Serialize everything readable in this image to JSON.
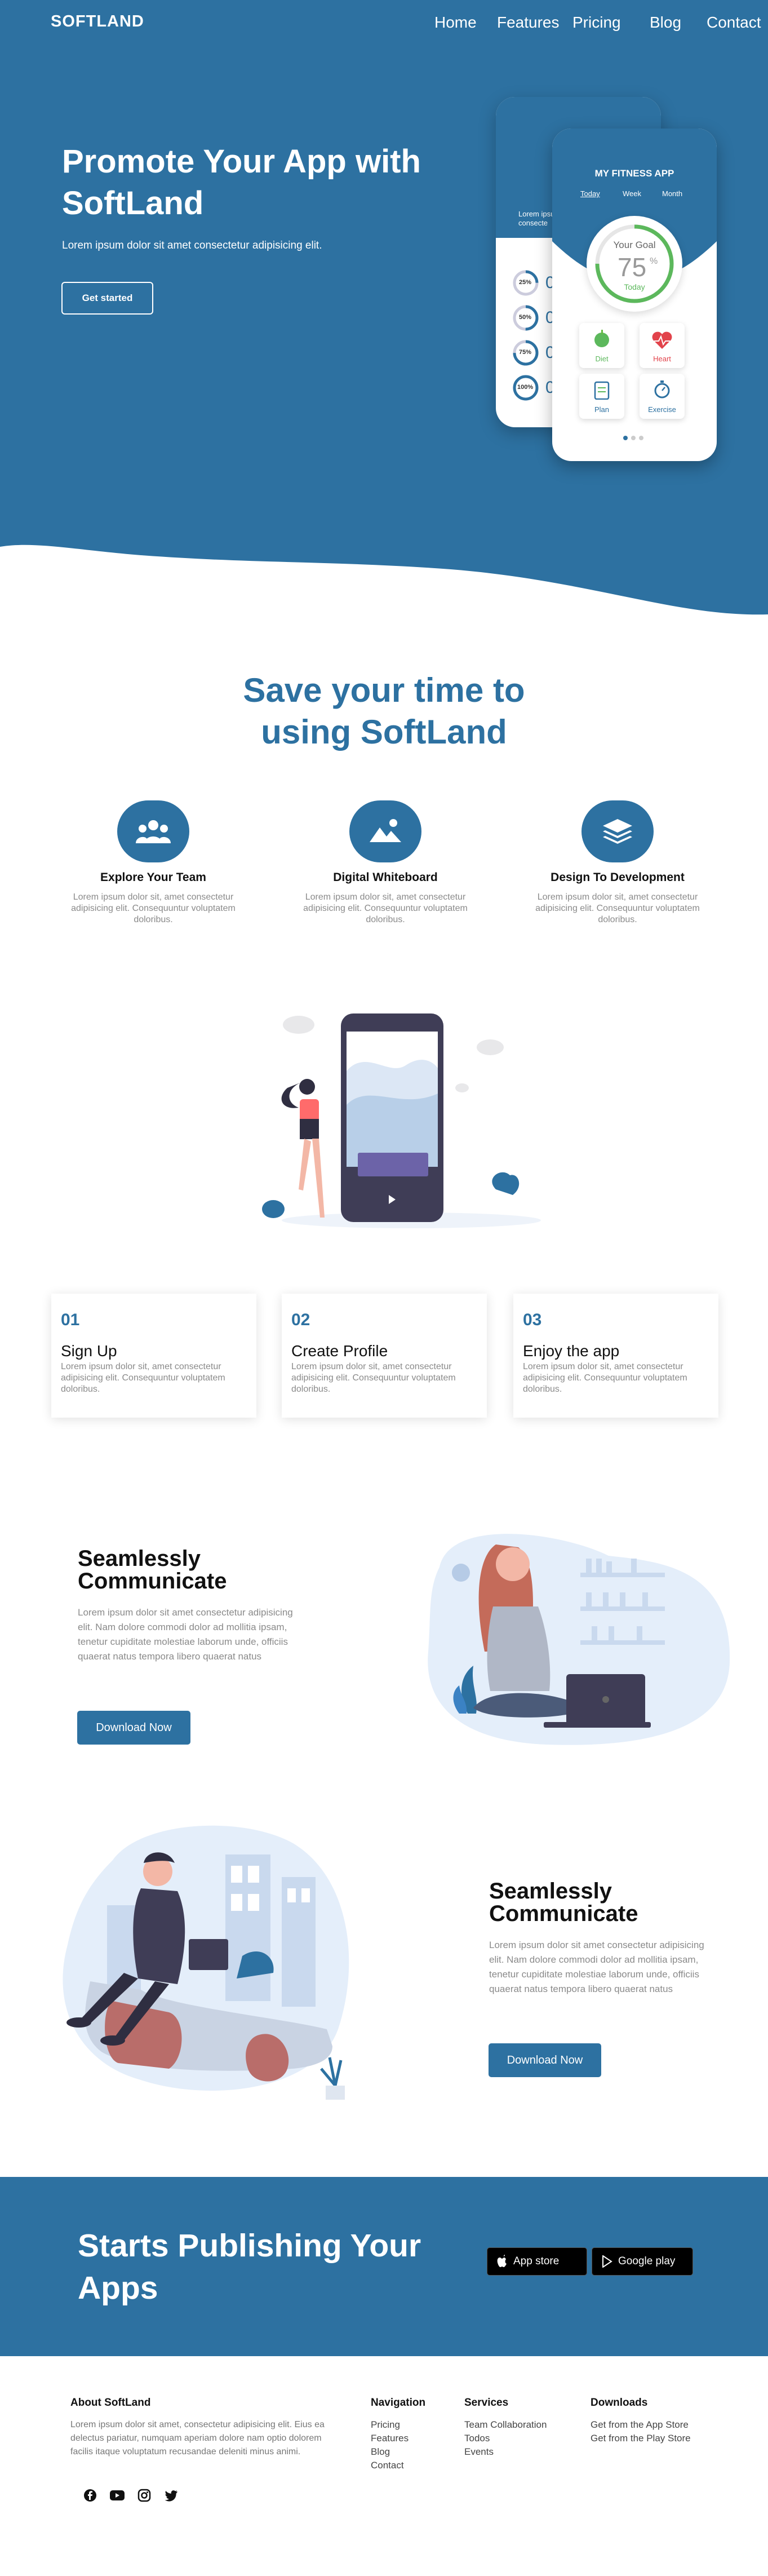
{
  "nav": {
    "brand": "SOFTLAND",
    "links": [
      "Home",
      "Features",
      "Pricing",
      "Blog",
      "Contact"
    ]
  },
  "hero": {
    "title": "Promote Your App with SoftLand",
    "subtitle": "Lorem ipsum dolor sit amet consectetur adipisicing elit.",
    "button": "Get started",
    "phone_back": {
      "snippet": "Lorem ipsum consecte",
      "rings": [
        "25%",
        "50%",
        "75%",
        "100%"
      ],
      "ring_side": [
        "0",
        "0",
        "0",
        "0"
      ]
    },
    "phone_front": {
      "app_title": "MY FITNESS APP",
      "tabs": [
        "Today",
        "Week",
        "Month"
      ],
      "goal_label": "Your Goal",
      "goal_value": "75",
      "goal_unit": "%",
      "goal_day": "Today",
      "goal_progress": 0.75,
      "tiles": [
        "Diet",
        "Heart",
        "Plan",
        "Exercise"
      ]
    }
  },
  "features": {
    "title_line1": "Save your time to",
    "title_line2": "using SoftLand",
    "items": [
      {
        "title": "Explore Your Team",
        "desc": "Lorem ipsum dolor sit, amet consectetur adipisicing elit. Consequuntur voluptatem doloribus."
      },
      {
        "title": "Digital Whiteboard",
        "desc": "Lorem ipsum dolor sit, amet consectetur adipisicing elit. Consequuntur voluptatem doloribus."
      },
      {
        "title": "Design To Development",
        "desc": "Lorem ipsum dolor sit, amet consectetur adipisicing elit. Consequuntur voluptatem doloribus."
      }
    ]
  },
  "steps": [
    {
      "num": "01",
      "title": "Sign Up",
      "desc": "Lorem ipsum dolor sit, amet consectetur adipisicing elit. Consequuntur voluptatem doloribus."
    },
    {
      "num": "02",
      "title": "Create Profile",
      "desc": "Lorem ipsum dolor sit, amet consectetur adipisicing elit. Consequuntur voluptatem doloribus."
    },
    {
      "num": "03",
      "title": "Enjoy the app",
      "desc": "Lorem ipsum dolor sit, amet consectetur adipisicing elit. Consequuntur voluptatem doloribus."
    }
  ],
  "communicate": [
    {
      "title_line1": "Seamlessly",
      "title_line2": "Communicate",
      "desc": "Lorem ipsum dolor sit amet consectetur adipisicing elit. Nam dolore commodi dolor ad mollitia ipsam, tenetur cupiditate molestiae laborum unde, officiis quaerat natus tempora libero quaerat natus",
      "button": "Download Now"
    },
    {
      "title_line1": "Seamlessly",
      "title_line2": "Communicate",
      "desc": "Lorem ipsum dolor sit amet consectetur adipisicing elit. Nam dolore commodi dolor ad mollitia ipsam, tenetur cupiditate molestiae laborum unde, officiis quaerat natus tempora libero quaerat natus",
      "button": "Download Now"
    }
  ],
  "cta": {
    "title_line1": "Starts Publishing Your",
    "title_line2": "Apps",
    "app_store": "App store",
    "google_play": "Google play"
  },
  "footer": {
    "about_title": "About SoftLand",
    "about_text": "Lorem ipsum dolor sit amet, consectetur adipisicing elit. Eius ea delectus pariatur, numquam aperiam dolore nam optio dolorem facilis itaque voluptatum recusandae deleniti minus animi.",
    "nav_title": "Navigation",
    "nav_links": [
      "Pricing",
      "Features",
      "Blog",
      "Contact"
    ],
    "services_title": "Services",
    "services_links": [
      "Team Collaboration",
      "Todos",
      "Events"
    ],
    "downloads_title": "Downloads",
    "downloads_links": [
      "Get from the App Store",
      "Get from the Play Store"
    ],
    "social_icons": [
      "facebook-icon",
      "youtube-icon",
      "instagram-icon",
      "twitter-icon"
    ]
  },
  "colors": {
    "primary": "#2d71a1",
    "accent_green": "#5cb85c",
    "light_blue": "#dde8f5"
  }
}
